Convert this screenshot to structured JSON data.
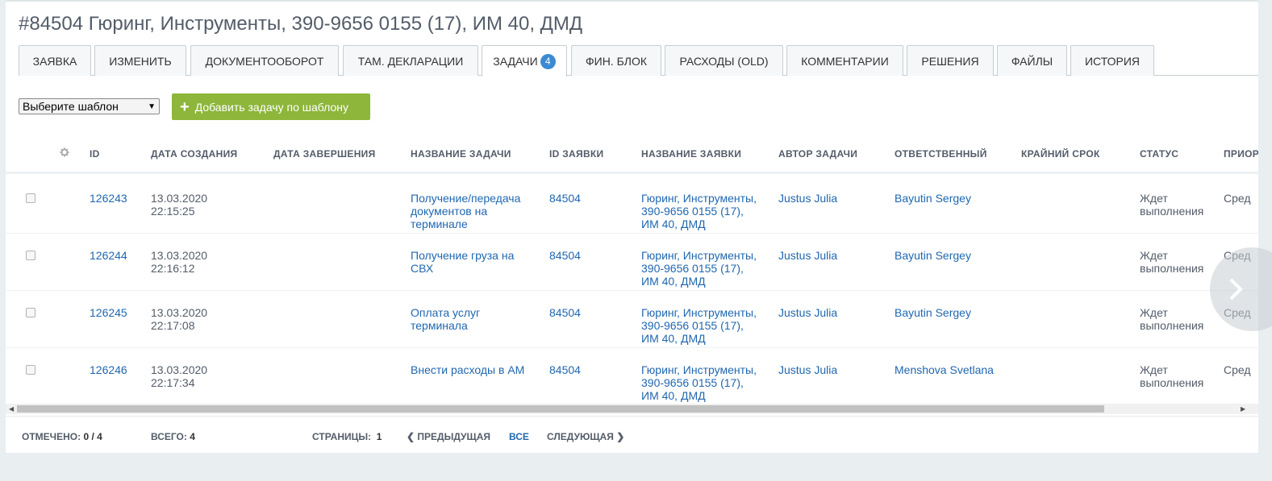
{
  "title": "#84504 Гюринг, Инструменты, 390-9656 0155 (17), ИМ 40, ДМД",
  "tabs": [
    {
      "label": "Заявка"
    },
    {
      "label": "Изменить"
    },
    {
      "label": "Документооборот"
    },
    {
      "label": "Там. декларации"
    },
    {
      "label": "Задачи",
      "badge": "4"
    },
    {
      "label": "Фин. блок"
    },
    {
      "label": "Расходы (OLD)"
    },
    {
      "label": "Комментарии"
    },
    {
      "label": "Решения"
    },
    {
      "label": "Файлы"
    },
    {
      "label": "История"
    }
  ],
  "toolbar": {
    "template_select": "Выберите шаблон",
    "add_button": "Добавить задачу по шаблону"
  },
  "columns": [
    "ID",
    "Дата создания",
    "Дата завершения",
    "Название задачи",
    "ID заявки",
    "Название заявки",
    "Автор задачи",
    "Ответственный",
    "Крайний срок",
    "Статус",
    "Приор"
  ],
  "rows": [
    {
      "id": "126243",
      "created_date": "13.03.2020",
      "created_time": "22:15:25",
      "name": [
        "Получение/передача",
        "документов на",
        "терминале"
      ],
      "request_id": "84504",
      "request_name": [
        "Гюринг, Инструменты,",
        "390-9656 0155 (17),",
        "ИМ 40, ДМД"
      ],
      "author": "Justus Julia",
      "responsible": "Bayutin Sergey",
      "status": [
        "Ждет",
        "выполнения"
      ],
      "priority": "Сред"
    },
    {
      "id": "126244",
      "created_date": "13.03.2020",
      "created_time": "22:16:12",
      "name": [
        "Получение груза на",
        "СВХ"
      ],
      "request_id": "84504",
      "request_name": [
        "Гюринг, Инструменты,",
        "390-9656 0155 (17),",
        "ИМ 40, ДМД"
      ],
      "author": "Justus Julia",
      "responsible": "Bayutin Sergey",
      "status": [
        "Ждет",
        "выполнения"
      ],
      "priority": "Сред"
    },
    {
      "id": "126245",
      "created_date": "13.03.2020",
      "created_time": "22:17:08",
      "name": [
        "Оплата услуг",
        "терминала"
      ],
      "request_id": "84504",
      "request_name": [
        "Гюринг, Инструменты,",
        "390-9656 0155 (17),",
        "ИМ 40, ДМД"
      ],
      "author": "Justus Julia",
      "responsible": "Bayutin Sergey",
      "status": [
        "Ждет",
        "выполнения"
      ],
      "priority": "Сред"
    },
    {
      "id": "126246",
      "created_date": "13.03.2020",
      "created_time": "22:17:34",
      "name": [
        "Внести расходы в АМ"
      ],
      "request_id": "84504",
      "request_name": [
        "Гюринг, Инструменты,",
        "390-9656 0155 (17),",
        "ИМ 40, ДМД"
      ],
      "author": "Justus Julia",
      "responsible": "Menshova Svetlana",
      "status": [
        "Ждет",
        "выполнения"
      ],
      "priority": "Сред"
    }
  ],
  "footer": {
    "checked_label": "Отмечено:",
    "checked_value": "0 / 4",
    "total_label": "Всего:",
    "total_value": "4",
    "pages_label": "Страницы:",
    "pages_value": "1",
    "prev": "Предыдущая",
    "all": "Все",
    "next": "Следующая"
  },
  "colors": {
    "accent": "#8db63a",
    "link": "#2067b0",
    "badge": "#3b8bd4"
  },
  "icons": [
    "gear-icon",
    "plus-icon",
    "chevron-left-icon",
    "chevron-right-icon"
  ]
}
